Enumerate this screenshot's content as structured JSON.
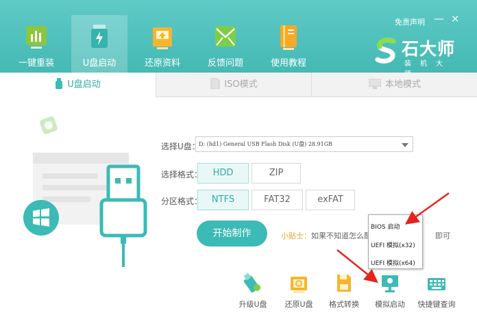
{
  "header": {
    "nav": [
      {
        "label": "一键重装",
        "icon": "bar-chart-icon"
      },
      {
        "label": "U盘启动",
        "icon": "usb-drive-icon"
      },
      {
        "label": "还原资料",
        "icon": "restore-box-icon"
      },
      {
        "label": "反馈问题",
        "icon": "feedback-mail-icon"
      },
      {
        "label": "使用教程",
        "icon": "tutorial-book-icon"
      }
    ],
    "active_index": 1,
    "disclaimer": "免责声明",
    "minimize": "—",
    "close": "×",
    "brand_name": "石大师",
    "brand_sub": "装机大师"
  },
  "tabs": [
    {
      "label": "U盘启动",
      "icon": "usb-icon"
    },
    {
      "label": "ISO模式",
      "icon": "iso-file-icon"
    },
    {
      "label": "本地模式",
      "icon": "monitor-icon"
    }
  ],
  "form": {
    "usb_label": "选择U盘：",
    "usb_value": "D: (hd1) General USB Flash Disk  (U盘) 28.91GB",
    "format_label": "选择格式：",
    "format_options": [
      "HDD",
      "ZIP"
    ],
    "partition_label": "分区格式：",
    "partition_options": [
      "NTFS",
      "FAT32",
      "exFAT"
    ],
    "start_button": "开始制作",
    "tip_prefix": "小贴士：",
    "tip_text": "如果不知道怎么配置",
    "tip_suffix": "即可"
  },
  "menu": [
    "BIOS 启动",
    "UEFI 模拟(x32)",
    "UEFI 模拟(x64)"
  ],
  "tools": [
    {
      "label": "升级U盘",
      "icon": "usb-upgrade-icon"
    },
    {
      "label": "还原U盘",
      "icon": "usb-restore-icon"
    },
    {
      "label": "格式转换",
      "icon": "format-convert-icon"
    },
    {
      "label": "模拟启动",
      "icon": "simulate-boot-icon"
    },
    {
      "label": "快捷键查询",
      "icon": "keyboard-icon"
    }
  ],
  "colors": {
    "accent": "#3cbab5",
    "header": "#4fc1bd",
    "tip_highlight": "#f0a02b",
    "arrow": "#e8231b"
  }
}
